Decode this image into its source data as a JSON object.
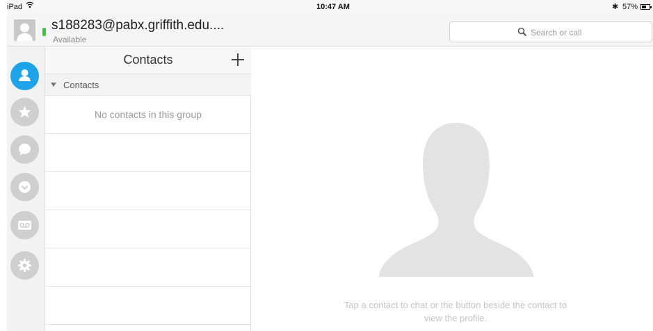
{
  "status_bar": {
    "device": "iPad",
    "time": "10:47 AM",
    "battery_text": "57%",
    "battery_level": 0.57
  },
  "header": {
    "username": "s188283@pabx.griffith.edu....",
    "status": "Available",
    "presence_color": "#3cc63c"
  },
  "search": {
    "placeholder": "Search or call"
  },
  "nav": {
    "active_color": "#1fa3e8",
    "items": [
      {
        "icon": "contacts-icon",
        "active": true
      },
      {
        "icon": "favorites-star-icon",
        "active": false
      },
      {
        "icon": "chat-icon",
        "active": false
      },
      {
        "icon": "recents-icon",
        "active": false
      },
      {
        "icon": "voicemail-icon",
        "active": false
      },
      {
        "icon": "settings-gear-icon",
        "active": false
      }
    ]
  },
  "contacts": {
    "title": "Contacts",
    "group_name": "Contacts",
    "empty_message": "No contacts in this group"
  },
  "detail": {
    "hint": "Tap a contact to chat or the button beside the contact to view the profile."
  }
}
